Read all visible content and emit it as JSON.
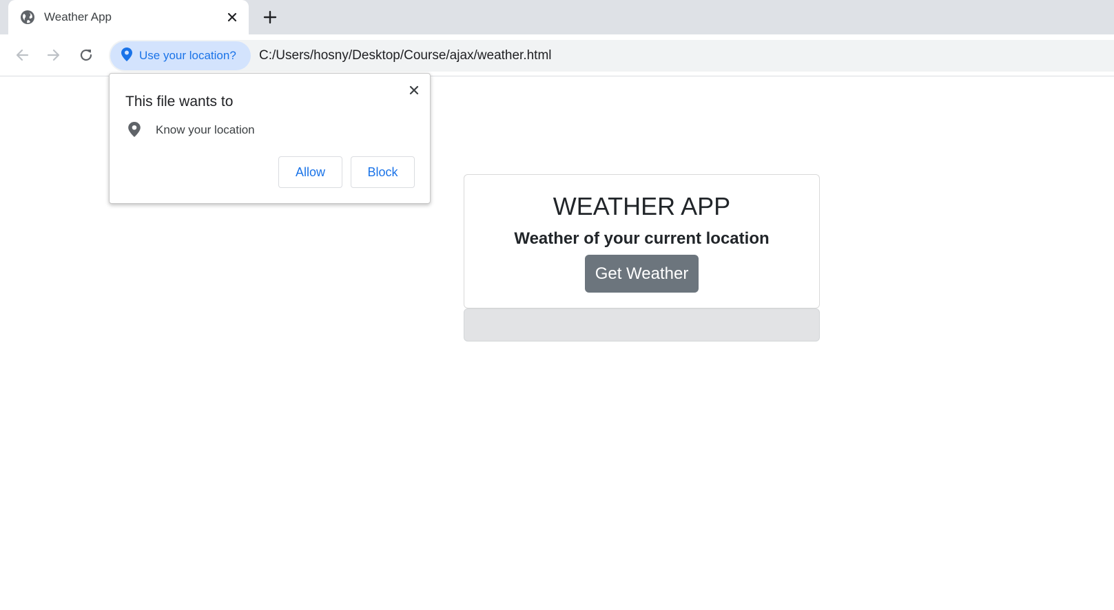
{
  "browser": {
    "tab": {
      "title": "Weather App",
      "favicon": "globe-icon",
      "close_icon": "close-icon"
    },
    "new_tab_icon": "plus-icon",
    "nav": {
      "back_icon": "back-arrow-icon",
      "forward_icon": "forward-arrow-icon",
      "reload_icon": "reload-icon"
    },
    "omnibox": {
      "location_chip_label": "Use your location?",
      "location_chip_icon": "location-pin-icon",
      "url": "C:/Users/hosny/Desktop/Course/ajax/weather.html"
    }
  },
  "permission_popup": {
    "title": "This file wants to",
    "permission_icon": "location-pin-icon",
    "permission_text": "Know your location",
    "allow_label": "Allow",
    "block_label": "Block",
    "close_icon": "close-icon"
  },
  "app": {
    "title": "WEATHER APP",
    "subtitle": "Weather of your current location",
    "button_label": "Get Weather",
    "result_text": ""
  },
  "colors": {
    "accent_blue": "#1a73e8",
    "chip_background": "#d3e3fd",
    "button_gray": "#6c757d",
    "result_background": "#e2e3e5",
    "tabstrip_background": "#dee1e6"
  }
}
